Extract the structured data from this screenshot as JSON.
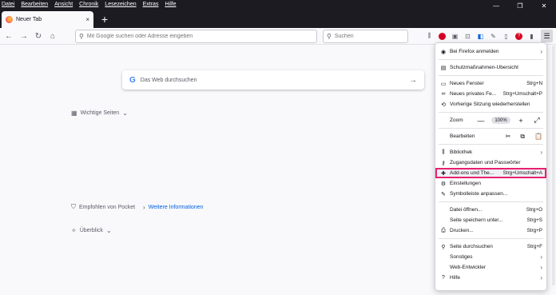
{
  "menubar": [
    "Datei",
    "Bearbeiten",
    "Ansicht",
    "Chronik",
    "Lesezeichen",
    "Extras",
    "Hilfe"
  ],
  "tab": {
    "title": "Neuer Tab",
    "close": "×",
    "new": "+"
  },
  "window": {
    "minimize": "—",
    "restore": "❐",
    "close": "✕"
  },
  "nav": {
    "back": "←",
    "forward": "→",
    "reload": "↻",
    "home": "⌂"
  },
  "urlbar": {
    "placeholder": "Mit Google suchen oder Adresse eingeben"
  },
  "searchbar": {
    "placeholder": "Suchen"
  },
  "content": {
    "websearch": {
      "logo": "G",
      "placeholder": "Das Web durchsuchen",
      "arrow": "→"
    },
    "top_sites": "Wichtige Seiten",
    "pocket": "Empfohlen von Pocket",
    "pocket_link": "Weitere Informationen",
    "highlights": "Überblick"
  },
  "menu": {
    "sign_in": "Bei Firefox anmelden",
    "protections": "Schutzmaßnahmen-Übersicht",
    "new_window": {
      "label": "Neues Fenster",
      "shortcut": "Strg+N"
    },
    "private_window": {
      "label": "Neues privates Fe...",
      "shortcut": "Strg+Umschalt+P"
    },
    "restore_session": "Vorherige Sitzung wiederherstellen",
    "zoom": {
      "label": "Zoom",
      "minus": "—",
      "value": "100%",
      "plus": "+",
      "fullscreen": "⤢"
    },
    "edit": {
      "label": "Bearbeiten",
      "cut": "✂",
      "copy": "⧉",
      "paste": "📋"
    },
    "library": "Bibliothek",
    "logins": "Zugangsdaten und Passwörter",
    "addons": {
      "label": "Add-ons und The...",
      "shortcut": "Strg+Umschalt+A"
    },
    "settings": "Einstellungen",
    "customize": "Symbolleiste anpassen...",
    "open_file": {
      "label": "Datei öffnen...",
      "shortcut": "Strg+O"
    },
    "save_page": {
      "label": "Seite speichern unter...",
      "shortcut": "Strg+S"
    },
    "print": {
      "label": "Drucken...",
      "shortcut": "Strg+P"
    },
    "find": {
      "label": "Seite durchsuchen",
      "shortcut": "Strg+F"
    },
    "more": "Sonstiges",
    "webdev": "Web-Entwickler",
    "help": "Hilfe"
  },
  "colors": {
    "titlebar": "#1c1b22",
    "highlight": "#e8226f",
    "link": "#0061e0"
  }
}
